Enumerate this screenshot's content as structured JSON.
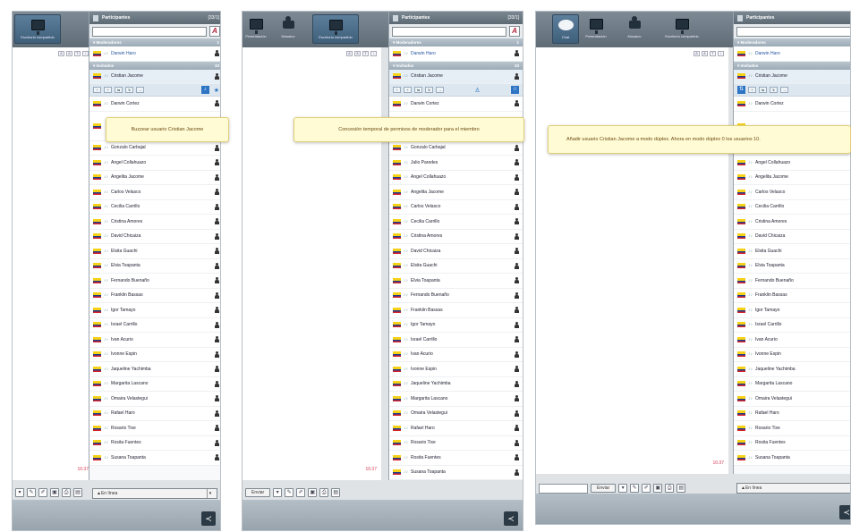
{
  "toolbar": {
    "chat": "Chat",
    "presentacion": "Presentación",
    "mosaico": "Mosaico",
    "escritorio": "Escritorio compartido"
  },
  "participants": {
    "title": "Participantes",
    "count": "[33/1]",
    "moderators_label": "Moderadores",
    "moderators_count": "1",
    "invited_label": "Invitados",
    "invited_count": "33",
    "moderators": [
      "Darwin Haro"
    ],
    "invited": [
      "Cristian Jacome",
      "Darwin Cortez",
      "Gonzalo Carbajal",
      "Julio Paredes",
      "Angel Collahuazo",
      "Angelita Jacome",
      "Carlos Velasco",
      "Cecilia Carrillo",
      "Cristina Amores",
      "David Chicaiza",
      "Elsita Guachi",
      "Elvia Toapanta",
      "Fernando Buenaño",
      "Franklin Bassas",
      "Igor Tamayo",
      "Israel Carrillo",
      "Ivan Acurio",
      "Ivonne Espin",
      "Jaqueline Yachimba",
      "Margarita Lascano",
      "Omaira Velastegui",
      "Rafael Haro",
      "Rosario Tixe",
      "Rosita Fuentes",
      "Susana Toapanta"
    ]
  },
  "chat": {
    "timestamp": "16:37",
    "send": "Enviar",
    "status": "En línea"
  },
  "tooltips": {
    "one": "Buzzear usuario Cristian Jacome",
    "two": "Concesión temporal de permisos de moderador para el miembro",
    "three": "Añadir usuario Cristian Jacome a modo dúplex. Ahora en modo dúplex 0 los usuarios 10."
  },
  "accent": "#2d74c4",
  "tooltip_color": "#fffbd4"
}
